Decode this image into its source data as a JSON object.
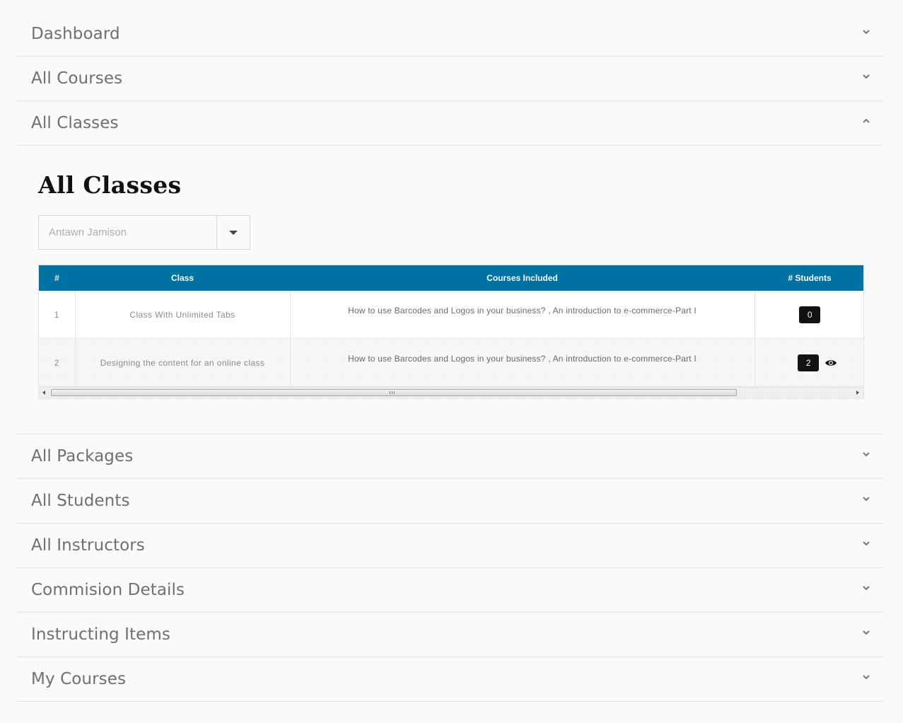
{
  "accordion": {
    "top_items": [
      {
        "label": "Dashboard",
        "expanded": false
      },
      {
        "label": "All Courses",
        "expanded": false
      },
      {
        "label": "All Classes",
        "expanded": true
      }
    ],
    "bottom_items": [
      {
        "label": "All Packages",
        "expanded": false
      },
      {
        "label": "All Students",
        "expanded": false
      },
      {
        "label": "All Instructors",
        "expanded": false
      },
      {
        "label": "Commision Details",
        "expanded": false
      },
      {
        "label": "Instructing Items",
        "expanded": false
      },
      {
        "label": "My Courses",
        "expanded": false
      }
    ]
  },
  "classes_panel": {
    "heading": "All Classes",
    "instructor_select": {
      "selected": "Antawn Jamison"
    },
    "table": {
      "headers": [
        "#",
        "Class",
        "Courses Included",
        "# Students"
      ],
      "rows": [
        {
          "num": "1",
          "class_name": "Class With Unlimited Tabs",
          "courses": "How to use Barcodes and Logos in your business? , An introduction to e-commerce-Part I",
          "students": "0",
          "has_view": false
        },
        {
          "num": "2",
          "class_name": "Designing the content for an online class",
          "courses": "How to use Barcodes and Logos in your business? , An introduction to e-commerce-Part I",
          "students": "2",
          "has_view": true
        }
      ]
    }
  },
  "icons": {
    "collapsed": "chevron-down-icon",
    "expanded": "chevron-up-icon",
    "select_toggle": "caret-down-icon",
    "view_students": "eye-icon"
  },
  "colors": {
    "table_header_bg": "#0072a3",
    "badge_bg": "#121212",
    "page_bg": "#fafafa"
  }
}
